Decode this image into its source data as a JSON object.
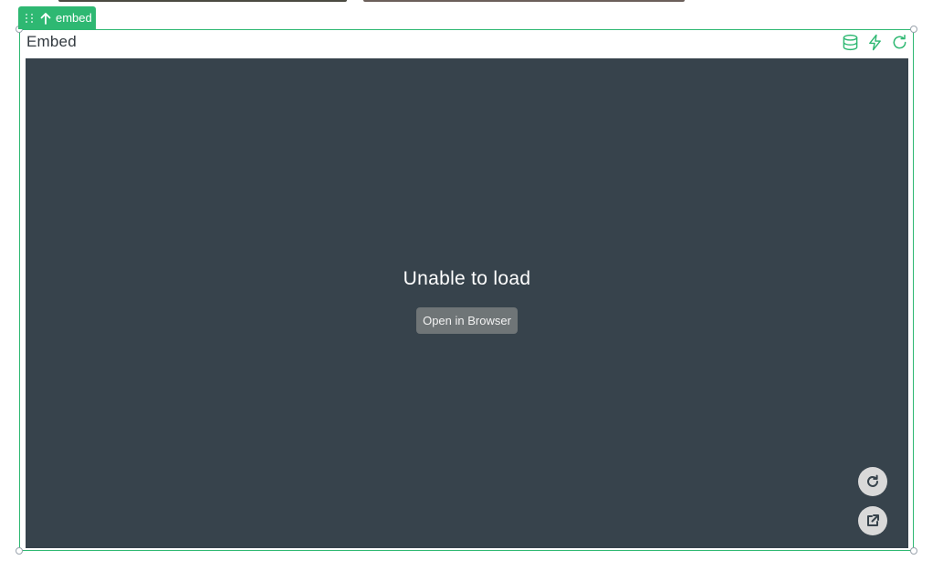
{
  "tag": {
    "label": "embed",
    "drag_icon": "drag-handle-icon",
    "arrow_icon": "arrow-up-icon"
  },
  "widget": {
    "title": "Embed",
    "actions": [
      {
        "name": "database-icon"
      },
      {
        "name": "lightning-icon"
      },
      {
        "name": "refresh-icon"
      }
    ]
  },
  "embed": {
    "error_title": "Unable to load",
    "open_button_label": "Open in Browser",
    "reload_icon": "reload-icon",
    "external_icon": "external-link-icon"
  },
  "colors": {
    "accent": "#2eb872",
    "embed_background": "#37434c",
    "button_background": "#6f7577",
    "float_button_background": "#d9d9d9"
  }
}
